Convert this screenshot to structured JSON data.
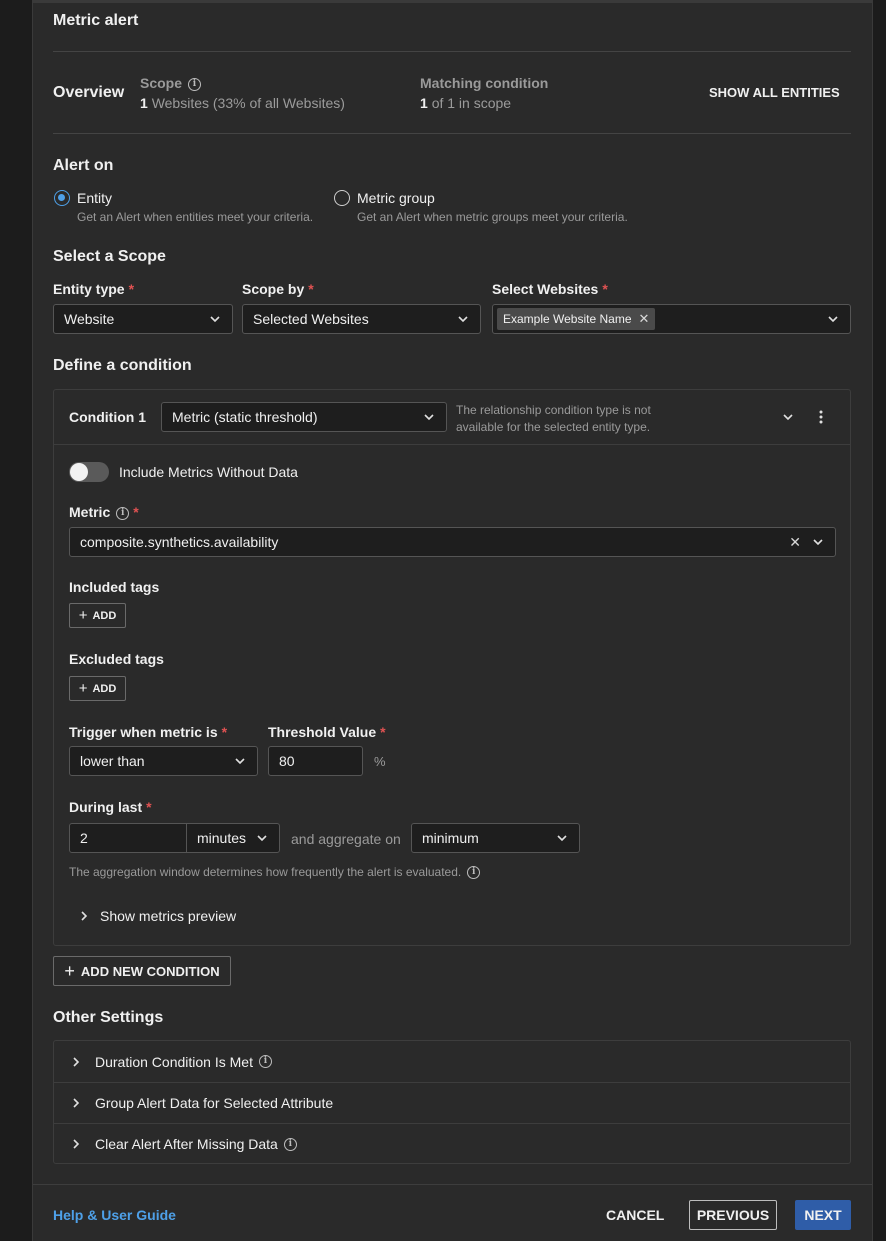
{
  "header": {
    "title": "Metric alert"
  },
  "overview": {
    "label": "Overview",
    "scope_label": "Scope",
    "scope_count": "1",
    "scope_text": "Websites (33% of all Websites)",
    "matching_label": "Matching condition",
    "matching_count": "1",
    "matching_text": "of 1 in scope",
    "show_all": "SHOW ALL ENTITIES"
  },
  "alert_on": {
    "title": "Alert on",
    "options": [
      {
        "label": "Entity",
        "desc": "Get an Alert when entities meet your criteria.",
        "selected": true
      },
      {
        "label": "Metric group",
        "desc": "Get an Alert when metric groups meet your criteria.",
        "selected": false
      }
    ]
  },
  "scope": {
    "title": "Select a Scope",
    "entity_type_label": "Entity type",
    "entity_type_value": "Website",
    "scope_by_label": "Scope by",
    "scope_by_value": "Selected Websites",
    "websites_label": "Select Websites",
    "website_chip": "Example Website Name"
  },
  "condition": {
    "title": "Define a condition",
    "name": "Condition 1",
    "type_value": "Metric (static threshold)",
    "type_note_line1": "The relationship condition type is not",
    "type_note_line2": "available for the selected entity type.",
    "include_without_data": "Include Metrics Without Data",
    "metric_label": "Metric",
    "metric_value": "composite.synthetics.availability",
    "included_tags_label": "Included tags",
    "excluded_tags_label": "Excluded tags",
    "add_label": "ADD",
    "trigger_label": "Trigger when metric is",
    "trigger_value": "lower than",
    "threshold_label": "Threshold Value",
    "threshold_value": "80",
    "threshold_unit": "%",
    "during_label": "During last",
    "during_value": "2",
    "during_unit": "minutes",
    "aggregate_label": "and aggregate on",
    "aggregate_value": "minimum",
    "aggregation_note": "The aggregation window determines how frequently the alert is evaluated.",
    "preview_label": "Show metrics preview"
  },
  "add_condition": "ADD NEW CONDITION",
  "other_settings": {
    "title": "Other Settings",
    "items": [
      {
        "label": "Duration Condition Is Met",
        "info": true
      },
      {
        "label": "Group Alert Data for Selected Attribute",
        "info": false
      },
      {
        "label": "Clear Alert After Missing Data",
        "info": true
      }
    ]
  },
  "footer": {
    "help": "Help & User Guide",
    "cancel": "CANCEL",
    "previous": "PREVIOUS",
    "next": "NEXT"
  },
  "colors": {
    "accent": "#4ea0e8",
    "primary_button": "#2f5da8",
    "required": "#e05252",
    "link": "#4ea0e8"
  }
}
